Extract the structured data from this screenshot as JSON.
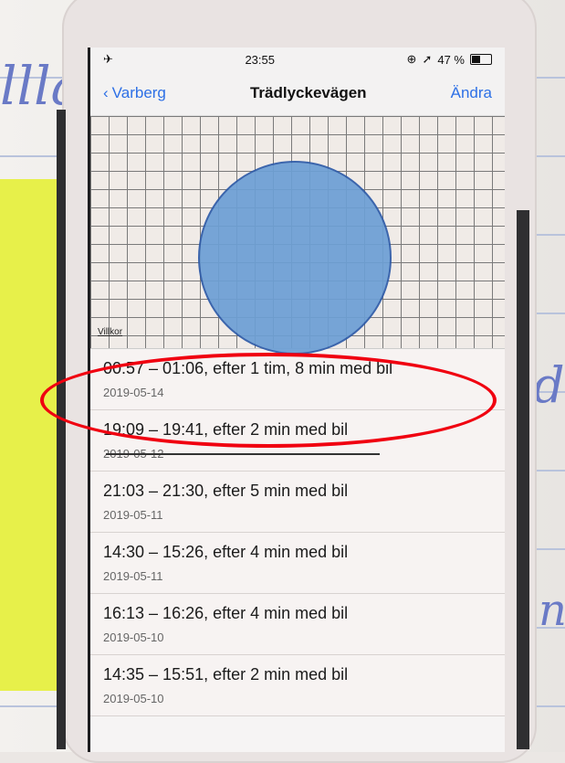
{
  "status_bar": {
    "time": "23:55",
    "battery_percent": "47 %",
    "battery_level": 0.47,
    "icons": [
      "airplane-mode-icon",
      "location-icon",
      "rotation-lock-icon",
      "battery-icon"
    ]
  },
  "nav": {
    "back_label": "Varberg",
    "title": "Trädlyckevägen",
    "edit_label": "Ändra"
  },
  "map": {
    "villkor_label": "Villkor",
    "circle_color": "#6c9fd5"
  },
  "list": [
    {
      "main": "00:57 – 01:06, efter 1 tim, 8 min med bil",
      "date": "2019-05-14",
      "highlighted": true
    },
    {
      "main": "19:09 – 19:41, efter 2 min med bil",
      "date": "2019-05-12"
    },
    {
      "main": "21:03 – 21:30, efter 5 min med bil",
      "date": "2019-05-11"
    },
    {
      "main": "14:30 – 15:26, efter 4 min med bil",
      "date": "2019-05-11"
    },
    {
      "main": "16:13 – 16:26, efter 4 min med bil",
      "date": "2019-05-10"
    },
    {
      "main": "14:35 – 15:51, efter 2 min med bil",
      "date": "2019-05-10"
    }
  ],
  "annotation_color": "#f00010"
}
